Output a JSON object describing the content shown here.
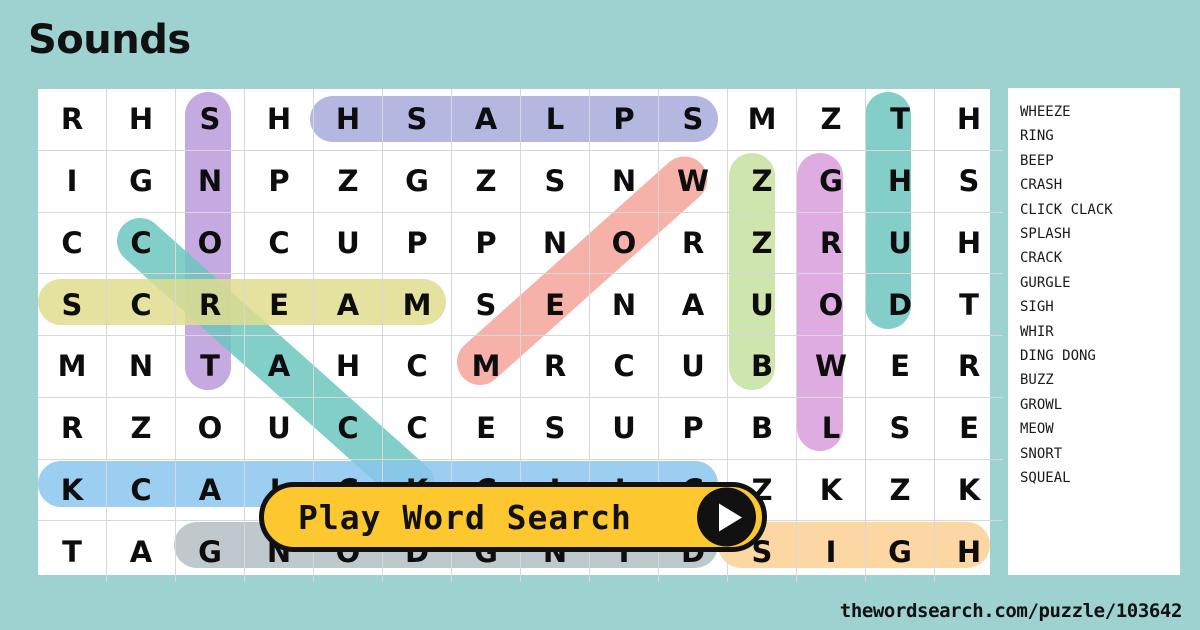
{
  "title": "Sounds",
  "background_color": "#9ed2d1",
  "footer_url": "thewordsearch.com/puzzle/103642",
  "play_button": {
    "label": "Play Word Search",
    "icon": "play-triangle-icon",
    "background_color": "#fdc82f"
  },
  "word_list": {
    "words": [
      "WHEEZE",
      "RING",
      "BEEP",
      "CRASH",
      "CLICK CLACK",
      "SPLASH",
      "CRACK",
      "GURGLE",
      "SIGH",
      "WHIR",
      "DING DONG",
      "BUZZ",
      "GROWL",
      "MEOW",
      "SNORT",
      "SQUEAL"
    ]
  },
  "grid": {
    "columns": 14,
    "rows": 8,
    "letters": [
      [
        "R",
        "H",
        "S",
        "H",
        "H",
        "S",
        "A",
        "L",
        "P",
        "S",
        "M",
        "Z",
        "T",
        "H"
      ],
      [
        "I",
        "G",
        "N",
        "P",
        "Z",
        "G",
        "Z",
        "S",
        "N",
        "W",
        "Z",
        "G",
        "H",
        "S"
      ],
      [
        "C",
        "C",
        "O",
        "C",
        "U",
        "P",
        "P",
        "N",
        "O",
        "R",
        "Z",
        "R",
        "U",
        "H"
      ],
      [
        "S",
        "C",
        "R",
        "E",
        "A",
        "M",
        "S",
        "E",
        "N",
        "A",
        "U",
        "O",
        "D",
        "T"
      ],
      [
        "M",
        "N",
        "T",
        "A",
        "H",
        "C",
        "M",
        "R",
        "C",
        "U",
        "B",
        "W",
        "E",
        "R"
      ],
      [
        "R",
        "Z",
        "O",
        "U",
        "C",
        "C",
        "E",
        "S",
        "U",
        "P",
        "B",
        "L",
        "S",
        "E"
      ],
      [
        "K",
        "C",
        "A",
        "L",
        "C",
        "K",
        "C",
        "I",
        "L",
        "C",
        "Z",
        "K",
        "Z",
        "K"
      ],
      [
        "T",
        "A",
        "G",
        "N",
        "O",
        "D",
        "G",
        "N",
        "I",
        "D",
        "S",
        "I",
        "G",
        "H"
      ]
    ]
  },
  "highlights": [
    {
      "word": "SPLASH",
      "color": "#a7aadb",
      "shape": "horizontal",
      "row": 1,
      "col_start": 5,
      "length": 6
    },
    {
      "word": "SNORT",
      "color": "#bb9adc",
      "shape": "vertical",
      "col": 3,
      "row_start": 1,
      "length": 5
    },
    {
      "word": "THUD",
      "color": "#6fc6c0",
      "shape": "vertical",
      "col": 13,
      "row_start": 1,
      "length": 4
    },
    {
      "word": "BUZZ",
      "color": "#c5e2a0",
      "shape": "vertical",
      "col": 11,
      "row_start": 2,
      "length": 4
    },
    {
      "word": "GROWL",
      "color": "#d99edd",
      "shape": "vertical",
      "col": 12,
      "row_start": 2,
      "length": 5
    },
    {
      "word": "MEOW",
      "color": "#f4a39a",
      "shape": "diagonal-up",
      "row_start": 5,
      "col_start": 7,
      "length": 4
    },
    {
      "word": "CRACK",
      "color": "#6cc5bf",
      "shape": "diagonal-down",
      "row_start": 3,
      "col_start": 2,
      "length": 5
    },
    {
      "word": "SCREAM",
      "color": "#e0dc8e",
      "shape": "horizontal",
      "row": 4,
      "col_start": 1,
      "length": 6
    },
    {
      "word": "CLICK CLACK",
      "color": "#8bc6ee",
      "shape": "horizontal",
      "row": 7,
      "col_start": 1,
      "length": 10
    },
    {
      "word": "DING DONG",
      "color": "#b4bfc4",
      "shape": "horizontal",
      "row": 8,
      "col_start": 3,
      "length": 8
    },
    {
      "word": "SIGH",
      "color": "#fbcf93",
      "shape": "horizontal",
      "row": 8,
      "col_start": 11,
      "length": 4
    }
  ]
}
